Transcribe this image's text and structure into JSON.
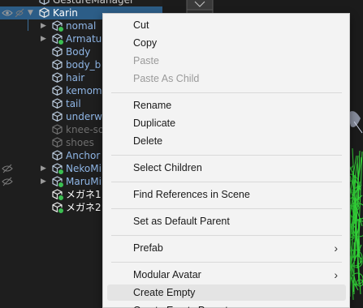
{
  "hierarchy": {
    "rows": [
      {
        "name": "GestureManager",
        "color": "#c9c9c9",
        "indent": 0,
        "foldout": false,
        "badge": false,
        "gutter": "",
        "selected": false
      },
      {
        "name": "Karin",
        "color": "#ffffff",
        "indent": 0,
        "foldout": true,
        "badge": false,
        "gutter": "eye",
        "selected": true
      },
      {
        "name": "nomal",
        "color": "#8fb6e6",
        "indent": 1,
        "foldout": true,
        "badge": true,
        "gutter": "",
        "selected": false
      },
      {
        "name": "Armature",
        "color": "#8fb6e6",
        "indent": 1,
        "foldout": true,
        "badge": true,
        "gutter": "",
        "selected": false
      },
      {
        "name": "Body",
        "color": "#8fb6e6",
        "indent": 1,
        "foldout": false,
        "badge": false,
        "gutter": "",
        "selected": false
      },
      {
        "name": "body_b",
        "color": "#8fb6e6",
        "indent": 1,
        "foldout": false,
        "badge": false,
        "gutter": "",
        "selected": false
      },
      {
        "name": "hair",
        "color": "#8fb6e6",
        "indent": 1,
        "foldout": false,
        "badge": false,
        "gutter": "",
        "selected": false
      },
      {
        "name": "kemomimi",
        "color": "#8fb6e6",
        "indent": 1,
        "foldout": false,
        "badge": false,
        "gutter": "",
        "selected": false
      },
      {
        "name": "tail",
        "color": "#8fb6e6",
        "indent": 1,
        "foldout": false,
        "badge": false,
        "gutter": "",
        "selected": false
      },
      {
        "name": "underwear",
        "color": "#8fb6e6",
        "indent": 1,
        "foldout": false,
        "badge": false,
        "gutter": "",
        "selected": false
      },
      {
        "name": "knee-socks",
        "color": "#6e6e6e",
        "indent": 1,
        "foldout": false,
        "badge": false,
        "gutter": "",
        "selected": false
      },
      {
        "name": "shoes",
        "color": "#6e6e6e",
        "indent": 1,
        "foldout": false,
        "badge": false,
        "gutter": "",
        "selected": false
      },
      {
        "name": "Anchor",
        "color": "#8fb6e6",
        "indent": 1,
        "foldout": false,
        "badge": false,
        "gutter": "",
        "selected": false
      },
      {
        "name": "NekoMimi",
        "color": "#8fb6e6",
        "indent": 1,
        "foldout": true,
        "badge": true,
        "gutter": "eye-off",
        "selected": false
      },
      {
        "name": "MaruMimi",
        "color": "#8fb6e6",
        "indent": 1,
        "foldout": true,
        "badge": true,
        "gutter": "eye-off",
        "selected": false
      },
      {
        "name": "メガネ1",
        "color": "#ffffff",
        "indent": 1,
        "foldout": false,
        "badge": true,
        "gutter": "",
        "selected": false
      },
      {
        "name": "メガネ2",
        "color": "#ffffff",
        "indent": 1,
        "foldout": false,
        "badge": true,
        "gutter": "",
        "selected": false
      }
    ]
  },
  "context_menu": {
    "items": [
      {
        "label": "Cut",
        "disabled": false,
        "submenu": false,
        "hover": false
      },
      {
        "label": "Copy",
        "disabled": false,
        "submenu": false,
        "hover": false
      },
      {
        "label": "Paste",
        "disabled": true,
        "submenu": false,
        "hover": false
      },
      {
        "label": "Paste As Child",
        "disabled": true,
        "submenu": false,
        "hover": false
      },
      {
        "separator": true
      },
      {
        "label": "Rename",
        "disabled": false,
        "submenu": false,
        "hover": false
      },
      {
        "label": "Duplicate",
        "disabled": false,
        "submenu": false,
        "hover": false
      },
      {
        "label": "Delete",
        "disabled": false,
        "submenu": false,
        "hover": false
      },
      {
        "separator": true
      },
      {
        "label": "Select Children",
        "disabled": false,
        "submenu": false,
        "hover": false
      },
      {
        "separator": true
      },
      {
        "label": "Find References in Scene",
        "disabled": false,
        "submenu": false,
        "hover": false
      },
      {
        "separator": true
      },
      {
        "label": "Set as Default Parent",
        "disabled": false,
        "submenu": false,
        "hover": false
      },
      {
        "separator": true
      },
      {
        "label": "Prefab",
        "disabled": false,
        "submenu": true,
        "hover": false
      },
      {
        "separator": true
      },
      {
        "label": "Modular Avatar",
        "disabled": false,
        "submenu": true,
        "hover": false
      },
      {
        "label": "Create Empty",
        "disabled": false,
        "submenu": false,
        "hover": true
      },
      {
        "label": "Create Empty Parent",
        "disabled": false,
        "submenu": false,
        "hover": false
      }
    ],
    "submenu_arrow": "›"
  },
  "colors": {
    "hierarchy_bg": "#1e1e1e",
    "selection": "#2c5d87",
    "menu_bg": "#f3f3f3",
    "menu_hover": "#e4e4e4",
    "prefab_blue": "#8fb6e6",
    "badge_green": "#3bbf52"
  }
}
